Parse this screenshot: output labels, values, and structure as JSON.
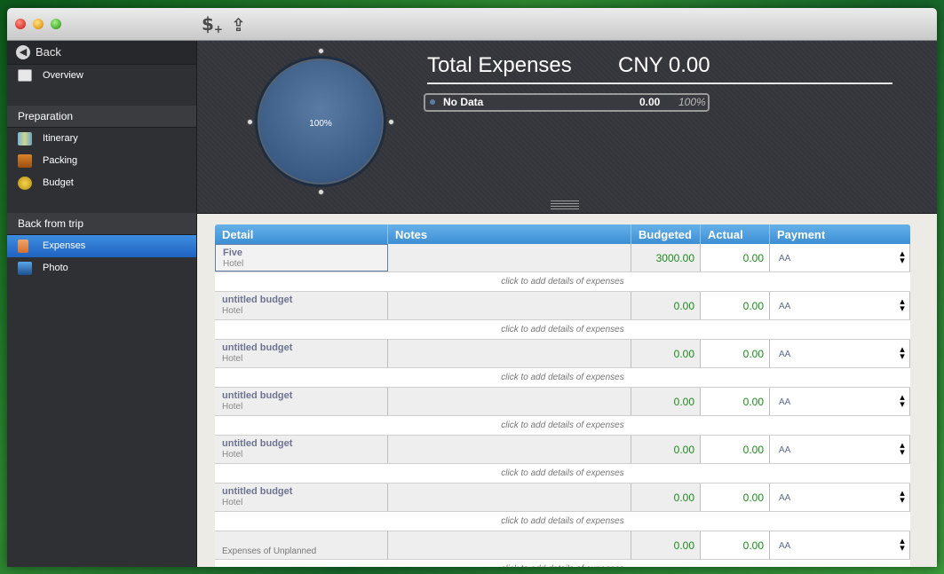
{
  "toolbar": {
    "add_label": "$",
    "add_sub": "+",
    "share_label": "⇪"
  },
  "sidebar": {
    "back": "Back",
    "back_icon": "◀",
    "overview": "Overview",
    "sections": [
      {
        "title": "Preparation",
        "items": [
          "Itinerary",
          "Packing",
          "Budget"
        ]
      },
      {
        "title": "Back from trip",
        "items": [
          "Expenses",
          "Photo"
        ]
      }
    ],
    "selected": "Expenses"
  },
  "summary": {
    "title": "Total Expenses",
    "amount": "CNY 0.00",
    "pie_label": "100%",
    "legend": {
      "name": "No Data",
      "value": "0.00",
      "percent": "100%"
    }
  },
  "table": {
    "headers": {
      "detail": "Detail",
      "notes": "Notes",
      "budgeted": "Budgeted",
      "actual": "Actual",
      "payment": "Payment"
    },
    "hint": "click to add details of expenses",
    "rows": [
      {
        "name": "Five",
        "category": "Hotel",
        "notes": "",
        "budgeted": "3000.00",
        "actual": "0.00",
        "payment": "AA"
      },
      {
        "name": "untitled budget",
        "category": "Hotel",
        "notes": "",
        "budgeted": "0.00",
        "actual": "0.00",
        "payment": "AA"
      },
      {
        "name": "untitled budget",
        "category": "Hotel",
        "notes": "",
        "budgeted": "0.00",
        "actual": "0.00",
        "payment": "AA"
      },
      {
        "name": "untitled budget",
        "category": "Hotel",
        "notes": "",
        "budgeted": "0.00",
        "actual": "0.00",
        "payment": "AA"
      },
      {
        "name": "untitled budget",
        "category": "Hotel",
        "notes": "",
        "budgeted": "0.00",
        "actual": "0.00",
        "payment": "AA"
      },
      {
        "name": "untitled budget",
        "category": "Hotel",
        "notes": "",
        "budgeted": "0.00",
        "actual": "0.00",
        "payment": "AA"
      }
    ],
    "unplanned": {
      "label": "Expenses of Unplanned",
      "budgeted": "0.00",
      "actual": "0.00",
      "payment": "AA"
    }
  },
  "colors": {
    "accent": "#3d8fd4",
    "selected": "#1f63c0",
    "value_green": "#1d8a1d"
  }
}
